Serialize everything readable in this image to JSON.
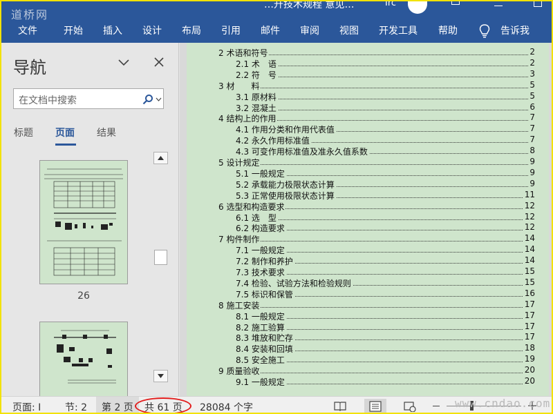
{
  "window": {
    "watermark": "道桥网",
    "title": "…升技术规程 意见…",
    "user_initials": "Irc"
  },
  "ribbon": {
    "tabs": [
      "文件",
      "开始",
      "插入",
      "设计",
      "布局",
      "引用",
      "邮件",
      "审阅",
      "视图",
      "开发工具",
      "帮助"
    ],
    "tell_me": "告诉我"
  },
  "nav": {
    "title": "导航",
    "search_placeholder": "在文档中搜索",
    "tabs": [
      "标题",
      "页面",
      "结果"
    ],
    "active_tab": "页面",
    "thumbnails": [
      {
        "page_label": "26"
      },
      {
        "page_label": ""
      }
    ]
  },
  "toc": [
    {
      "num": "2",
      "title": "术语和符号",
      "page": "2",
      "level": 1
    },
    {
      "num": "2.1",
      "title": "术　语",
      "page": "2",
      "level": 2
    },
    {
      "num": "2.2",
      "title": "符　号",
      "page": "3",
      "level": 2
    },
    {
      "num": "3",
      "title": "材　　料",
      "page": "5",
      "level": 1
    },
    {
      "num": "3.1",
      "title": "原材料",
      "page": "5",
      "level": 2
    },
    {
      "num": "3.2",
      "title": "混凝土",
      "page": "6",
      "level": 2
    },
    {
      "num": "4",
      "title": "结构上的作用",
      "page": "7",
      "level": 1
    },
    {
      "num": "4.1",
      "title": "作用分类和作用代表值",
      "page": "7",
      "level": 2
    },
    {
      "num": "4.2",
      "title": "永久作用标准值",
      "page": "7",
      "level": 2
    },
    {
      "num": "4.3",
      "title": "可变作用标准值及准永久值系数",
      "page": "8",
      "level": 2
    },
    {
      "num": "5",
      "title": "设计规定",
      "page": "9",
      "level": 1
    },
    {
      "num": "5.1",
      "title": "一般规定",
      "page": "9",
      "level": 2
    },
    {
      "num": "5.2",
      "title": "承载能力极限状态计算",
      "page": "9",
      "level": 2
    },
    {
      "num": "5.3",
      "title": "正常使用极限状态计算",
      "page": "11",
      "level": 2
    },
    {
      "num": "6",
      "title": "选型和构造要求",
      "page": "12",
      "level": 1
    },
    {
      "num": "6.1",
      "title": "选　型",
      "page": "12",
      "level": 2
    },
    {
      "num": "6.2",
      "title": "构造要求",
      "page": "12",
      "level": 2
    },
    {
      "num": "7",
      "title": "构件制作",
      "page": "14",
      "level": 1
    },
    {
      "num": "7.1",
      "title": "一般规定",
      "page": "14",
      "level": 2
    },
    {
      "num": "7.2",
      "title": "制作和养护",
      "page": "14",
      "level": 2
    },
    {
      "num": "7.3",
      "title": "技术要求",
      "page": "15",
      "level": 2
    },
    {
      "num": "7.4",
      "title": "检验、试验方法和检验规则",
      "page": "15",
      "level": 2
    },
    {
      "num": "7.5",
      "title": "标识和保管",
      "page": "16",
      "level": 2
    },
    {
      "num": "8",
      "title": "施工安装",
      "page": "17",
      "level": 1
    },
    {
      "num": "8.1",
      "title": "一般规定",
      "page": "17",
      "level": 2
    },
    {
      "num": "8.2",
      "title": "施工验算",
      "page": "17",
      "level": 2
    },
    {
      "num": "8.3",
      "title": "堆放和贮存",
      "page": "17",
      "level": 2
    },
    {
      "num": "8.4",
      "title": "安装和回填",
      "page": "18",
      "level": 2
    },
    {
      "num": "8.5",
      "title": "安全施工",
      "page": "19",
      "level": 2
    },
    {
      "num": "9",
      "title": "质量验收",
      "page": "20",
      "level": 1
    },
    {
      "num": "9.1",
      "title": "一般规定",
      "page": "20",
      "level": 2
    }
  ],
  "status": {
    "page": "页面: I",
    "section": "节: 2",
    "page_of": "第 2 页",
    "total": "共 61 页",
    "word_count": "28084 个字",
    "watermark": "www.cndao.com"
  },
  "colors": {
    "ribbon": "#2b579a",
    "page_background": "#cfe5cc",
    "highlight_circle": "#e21d1d",
    "frame_border": "#f2e200"
  }
}
